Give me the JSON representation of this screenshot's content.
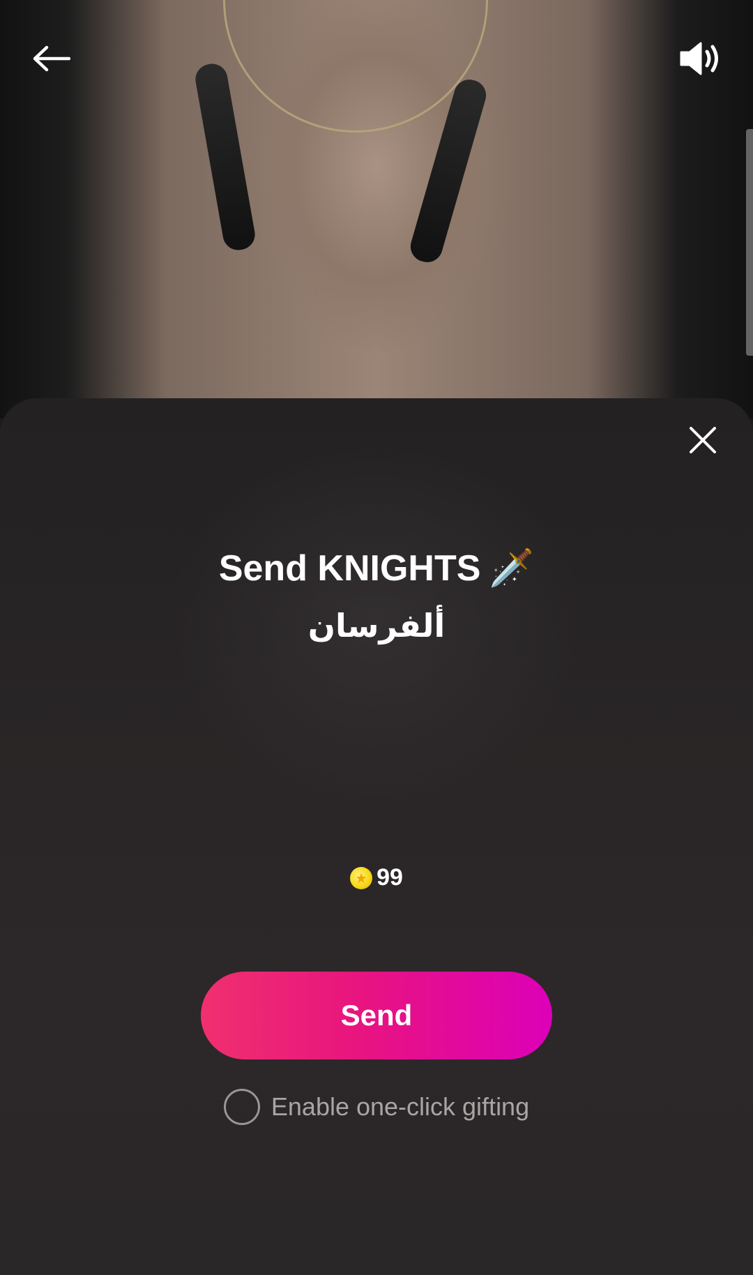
{
  "header": {
    "back_icon": "arrow-left-icon",
    "sound_icon": "speaker-volume-icon"
  },
  "gift_sheet": {
    "close_icon": "close-icon",
    "title": "Send KNIGHTS",
    "title_emoji": "🗡️",
    "subtitle": "ألفرسان",
    "price_icon": "coin-icon",
    "price": "99",
    "send_label": "Send",
    "one_click_label": "Enable one-click gifting",
    "one_click_checked": false
  },
  "colors": {
    "sheet_bg": "#252223",
    "send_gradient_start": "#f0306f",
    "send_gradient_end": "#dc00b8",
    "coin": "#f7d81a",
    "muted_text": "#a9a5a5"
  }
}
